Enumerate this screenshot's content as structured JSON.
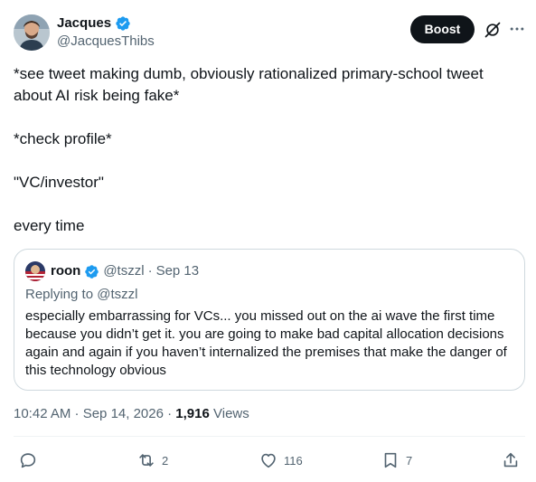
{
  "author": {
    "display_name": "Jacques",
    "handle": "@JacquesThibs"
  },
  "header": {
    "boost_label": "Boost",
    "grok_icon": "grok-icon",
    "more_icon": "more-icon"
  },
  "tweet": {
    "lines": [
      "*see tweet making dumb, obviously rationalized primary-school tweet about AI risk being fake*",
      "*check profile*",
      "\"VC/investor\"",
      "every time"
    ]
  },
  "quote": {
    "display_name": "roon",
    "handle": "@tszzl",
    "dot": "·",
    "date": "Sep 13",
    "replying_to": "Replying to @tszzl",
    "text": "especially embarrassing for VCs... you missed out on the ai wave the first time because you didn’t get it. you are going to make bad capital allocation decisions again and again if you haven’t internalized the premises that make the danger of this technology obvious"
  },
  "meta": {
    "timestamp": "10:42 AM · Sep 14, 2026 · ",
    "views_count": "1,916",
    "views_label": " Views"
  },
  "actions": {
    "reply_count": "",
    "repost_count": "2",
    "like_count": "116",
    "bookmark_count": "7"
  },
  "colors": {
    "verified": "#1d9bf0",
    "text_primary": "#0f1419",
    "text_secondary": "#536471",
    "border": "#cfd9de"
  }
}
